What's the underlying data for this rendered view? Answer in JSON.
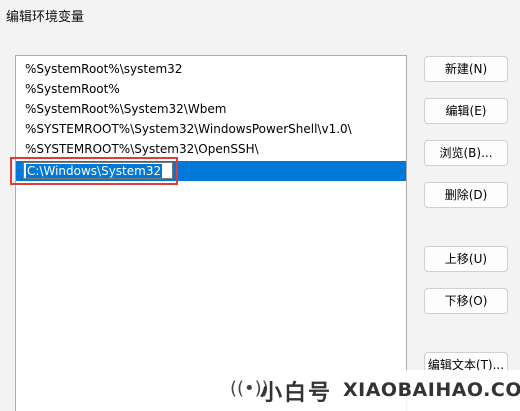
{
  "window": {
    "title": "编辑环境变量"
  },
  "path_list": {
    "items": [
      "%SystemRoot%\\system32",
      "%SystemRoot%",
      "%SystemRoot%\\System32\\Wbem",
      "%SYSTEMROOT%\\System32\\WindowsPowerShell\\v1.0\\",
      "%SYSTEMROOT%\\System32\\OpenSSH\\"
    ],
    "editing_value": "C:\\Windows\\System32"
  },
  "buttons": {
    "new": "新建(N)",
    "edit": "编辑(E)",
    "browse": "浏览(B)...",
    "delete": "删除(D)",
    "move_up": "上移(U)",
    "move_down": "下移(O)",
    "edit_text": "编辑文本(T)..."
  },
  "watermark": {
    "icon": "broadcast-icon",
    "cn_text": "小白号",
    "en_text": "XIAOBAIHAO.COM"
  },
  "colors": {
    "selection": "#0078d7",
    "highlight_border": "#e03a3a"
  }
}
